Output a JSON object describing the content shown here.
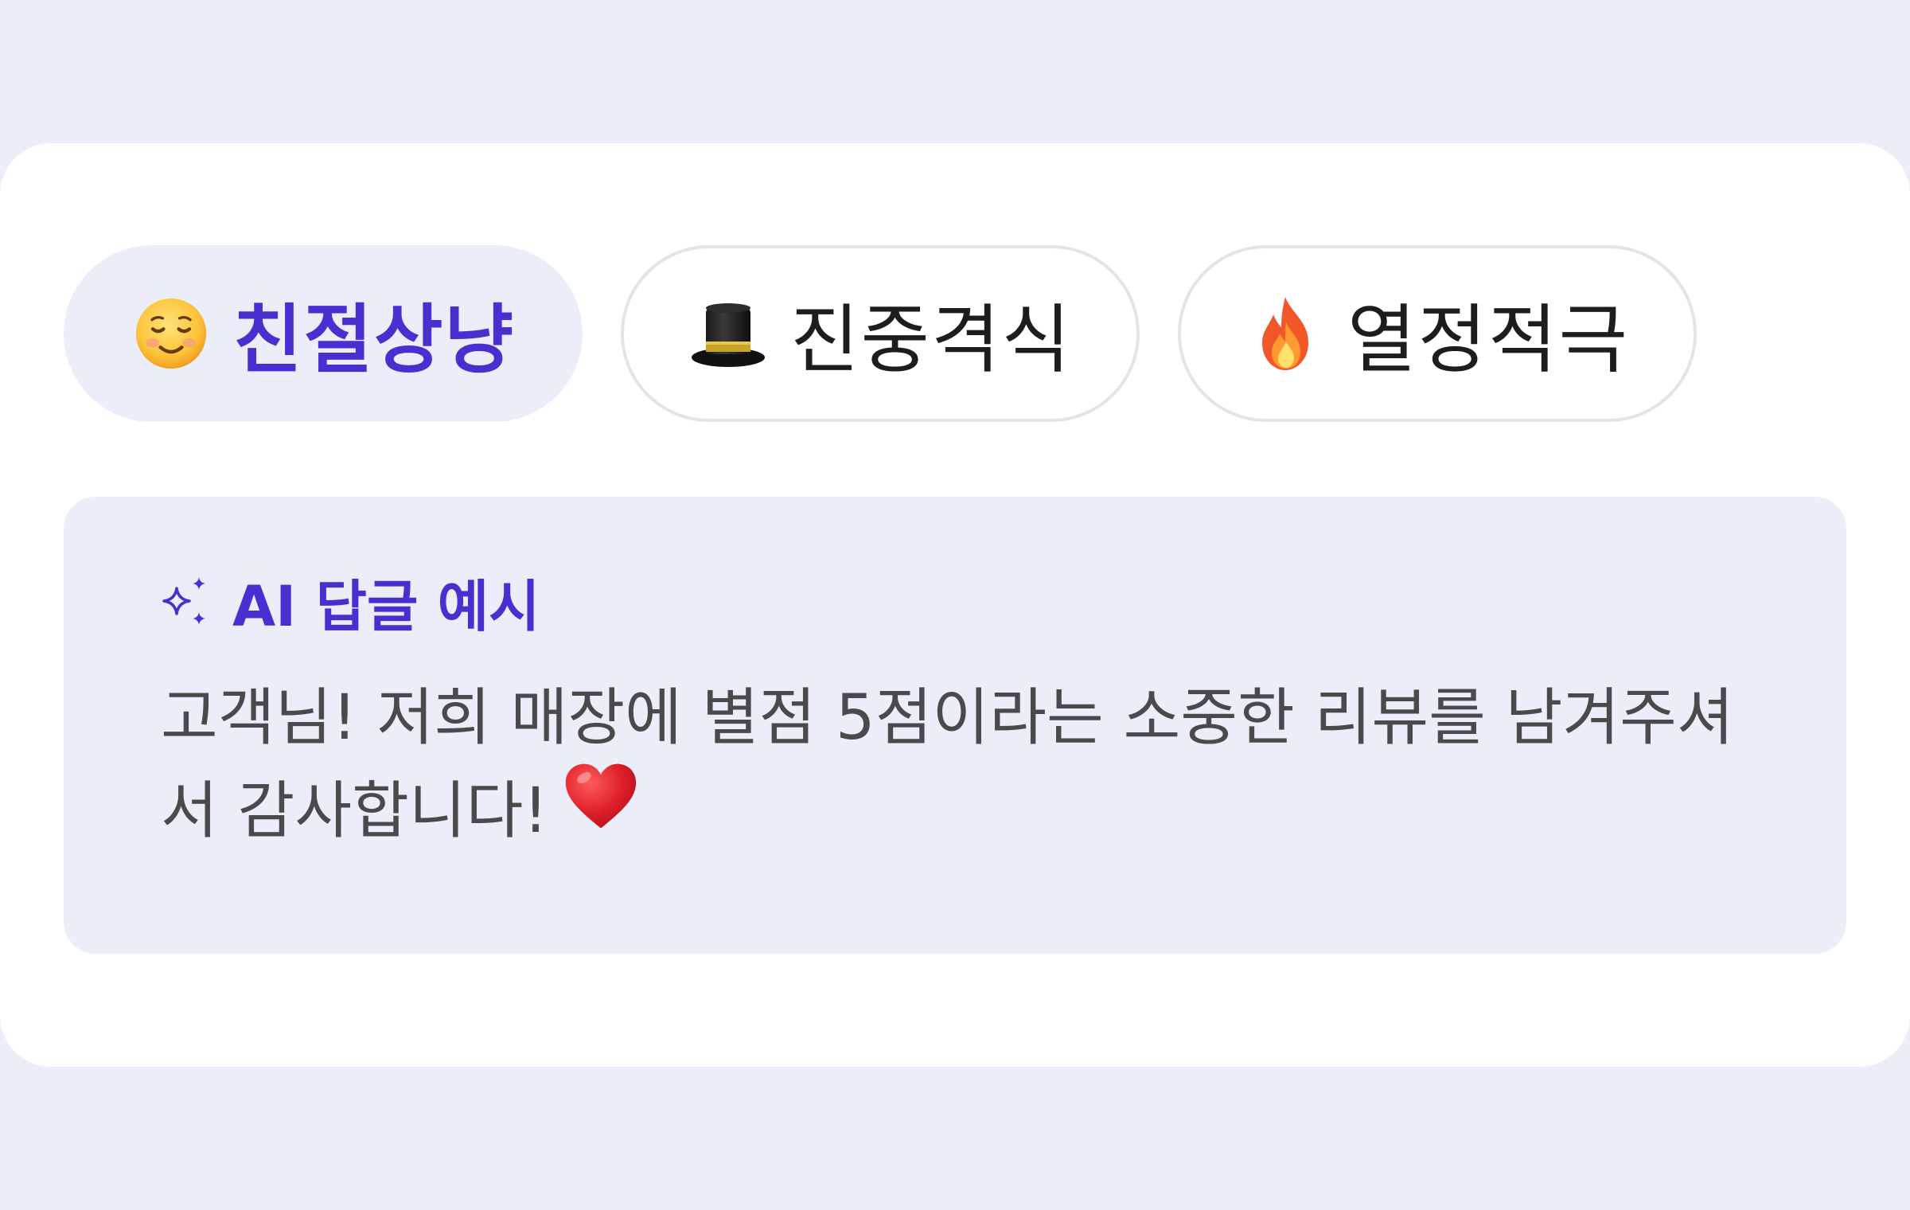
{
  "tones": [
    {
      "icon": "smiling-face-icon",
      "label": "친절상냥",
      "selected": true
    },
    {
      "icon": "top-hat-icon",
      "label": "진중격식",
      "selected": false
    },
    {
      "icon": "fire-icon",
      "label": "열정적극",
      "selected": false
    }
  ],
  "example": {
    "icon": "sparkles-icon",
    "title": "AI 답글 예시",
    "text": "고객님! 저희 매장에 별점 5점이라는 소중한 리뷰를 남겨주셔서 감사합니다!",
    "trailing_icon": "heart-icon"
  },
  "colors": {
    "page_background": "#ebedf9",
    "card": "#ffffff",
    "accent": "#4a2fd0",
    "body_text": "#4a4a4c",
    "chip_border": "#e4e4e4"
  }
}
